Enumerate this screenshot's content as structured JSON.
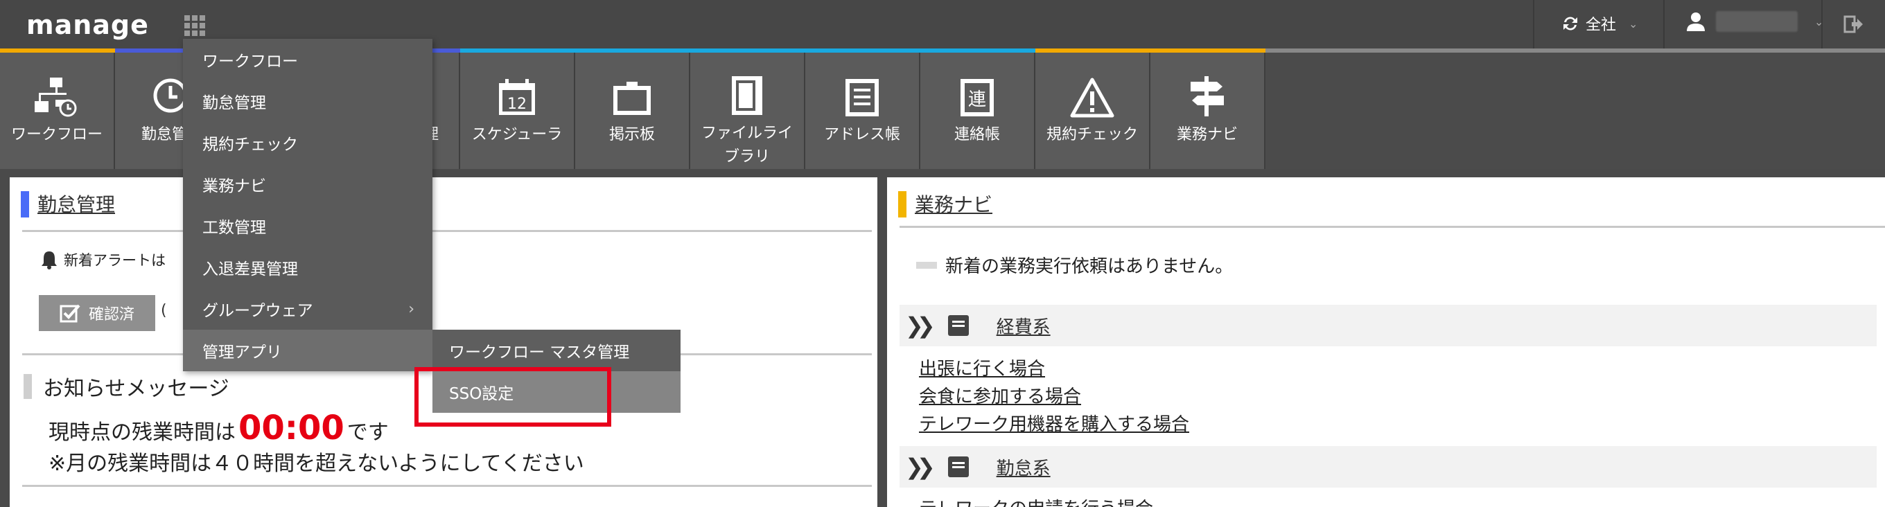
{
  "header": {
    "logo": "manage",
    "scope_label": "全社",
    "user_name": ""
  },
  "colors": {
    "strip": [
      "#f2a900",
      "#4a5bd8",
      "#4a5bd8",
      "#4a5bd8",
      "#19a9e0",
      "#19a9e0",
      "#19a9e0",
      "#19a9e0",
      "#19a9e0",
      "#f2a900",
      "#f2a900"
    ],
    "attendance_accent": "#4a6cf7",
    "navi_accent": "#f2b400",
    "overtime_red": "#e60012",
    "highlight_red": "#e8001c"
  },
  "toolbar": {
    "items": [
      {
        "label": "ワークフロー",
        "icon": "workflow-icon"
      },
      {
        "label": "勤怠管理",
        "icon": "clock-icon"
      },
      {
        "label": "",
        "icon": ""
      },
      {
        "label": "工数管理",
        "icon": ""
      },
      {
        "label": "スケジューラ",
        "icon": "calendar-icon"
      },
      {
        "label": "掲示板",
        "icon": "board-icon"
      },
      {
        "label": "ファイルライブラリ",
        "icon": "file-library-icon"
      },
      {
        "label": "アドレス帳",
        "icon": "address-book-icon"
      },
      {
        "label": "連絡帳",
        "icon": "contact-book-icon"
      },
      {
        "label": "規約チェック",
        "icon": "warning-icon"
      },
      {
        "label": "業務ナビ",
        "icon": "signpost-icon"
      }
    ],
    "calendar_day": "12",
    "contact_char": "連"
  },
  "left_panel": {
    "title": "勤怠管理",
    "alert_text": "新着アラートは",
    "confirm_button": "確認済",
    "confirm_paren": "(",
    "notice_title": "お知らせメッセージ",
    "overtime_prefix": "現時点の残業時間は",
    "overtime_value": "00:00",
    "overtime_suffix": "です",
    "overtime_note": "※月の残業時間は４０時間を超えないようにしてください"
  },
  "right_panel": {
    "title": "業務ナビ",
    "empty_message": "新着の業務実行依頼はありません。",
    "categories": [
      {
        "name": "経費系",
        "links": [
          "出張に行く場合",
          "会食に参加する場合",
          "テレワーク用機器を購入する場合"
        ]
      },
      {
        "name": "勤怠系",
        "links": [
          "テレワークの申請を行う場合"
        ]
      }
    ]
  },
  "menu": {
    "items": [
      "ワークフロー",
      "勤怠管理",
      "規約チェック",
      "業務ナビ",
      "工数管理",
      "入退差異管理",
      "グループウェア",
      "管理アプリ"
    ],
    "submenu_chevron": "›",
    "submenu": [
      "ワークフロー マスタ管理",
      "SSO設定"
    ]
  }
}
